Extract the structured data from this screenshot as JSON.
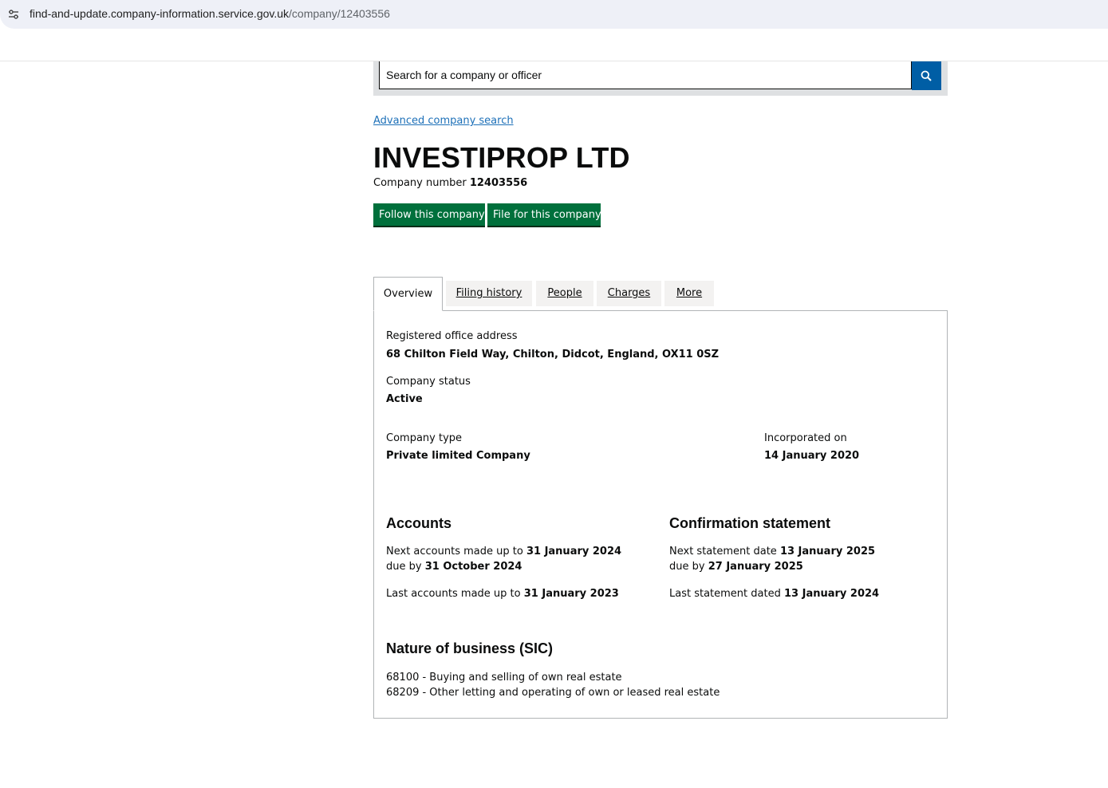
{
  "browser": {
    "url_host": "find-and-update.company-information.service.gov.uk",
    "url_path": "/company/12403556",
    "site_info_icon": "tune-icon"
  },
  "search": {
    "placeholder": "Search for a company or officer",
    "button_icon": "search-icon"
  },
  "advanced_search_label": "Advanced company search",
  "company": {
    "name": "INVESTIPROP LTD",
    "number_label": "Company number",
    "number": "12403556"
  },
  "actions": {
    "follow_label": "Follow this company",
    "file_label": "File for this company"
  },
  "tabs": [
    {
      "label": "Overview",
      "active": true
    },
    {
      "label": "Filing history",
      "active": false
    },
    {
      "label": "People",
      "active": false
    },
    {
      "label": "Charges",
      "active": false
    },
    {
      "label": "More",
      "active": false
    }
  ],
  "overview": {
    "registered_office_label": "Registered office address",
    "registered_office": "68 Chilton Field Way, Chilton, Didcot, England, OX11 0SZ",
    "status_label": "Company status",
    "status": "Active",
    "type_label": "Company type",
    "type": "Private limited Company",
    "incorporated_label": "Incorporated on",
    "incorporated": "14 January 2020"
  },
  "accounts": {
    "heading": "Accounts",
    "next_prefix": "Next accounts made up to",
    "next_date": "31 January 2024",
    "due_prefix": "due by",
    "due_date": "31 October 2024",
    "last_prefix": "Last accounts made up to",
    "last_date": "31 January 2023"
  },
  "confirmation": {
    "heading": "Confirmation statement",
    "next_prefix": "Next statement date",
    "next_date": "13 January 2025",
    "due_prefix": "due by",
    "due_date": "27 January 2025",
    "last_prefix": "Last statement dated",
    "last_date": "13 January 2024"
  },
  "sic": {
    "heading": "Nature of business (SIC)",
    "items": [
      "68100 - Buying and selling of own real estate",
      "68209 - Other letting and operating of own or leased real estate"
    ]
  },
  "colors": {
    "green_button": "#00703c",
    "search_button": "#005ea5",
    "link": "#1d70b8"
  }
}
